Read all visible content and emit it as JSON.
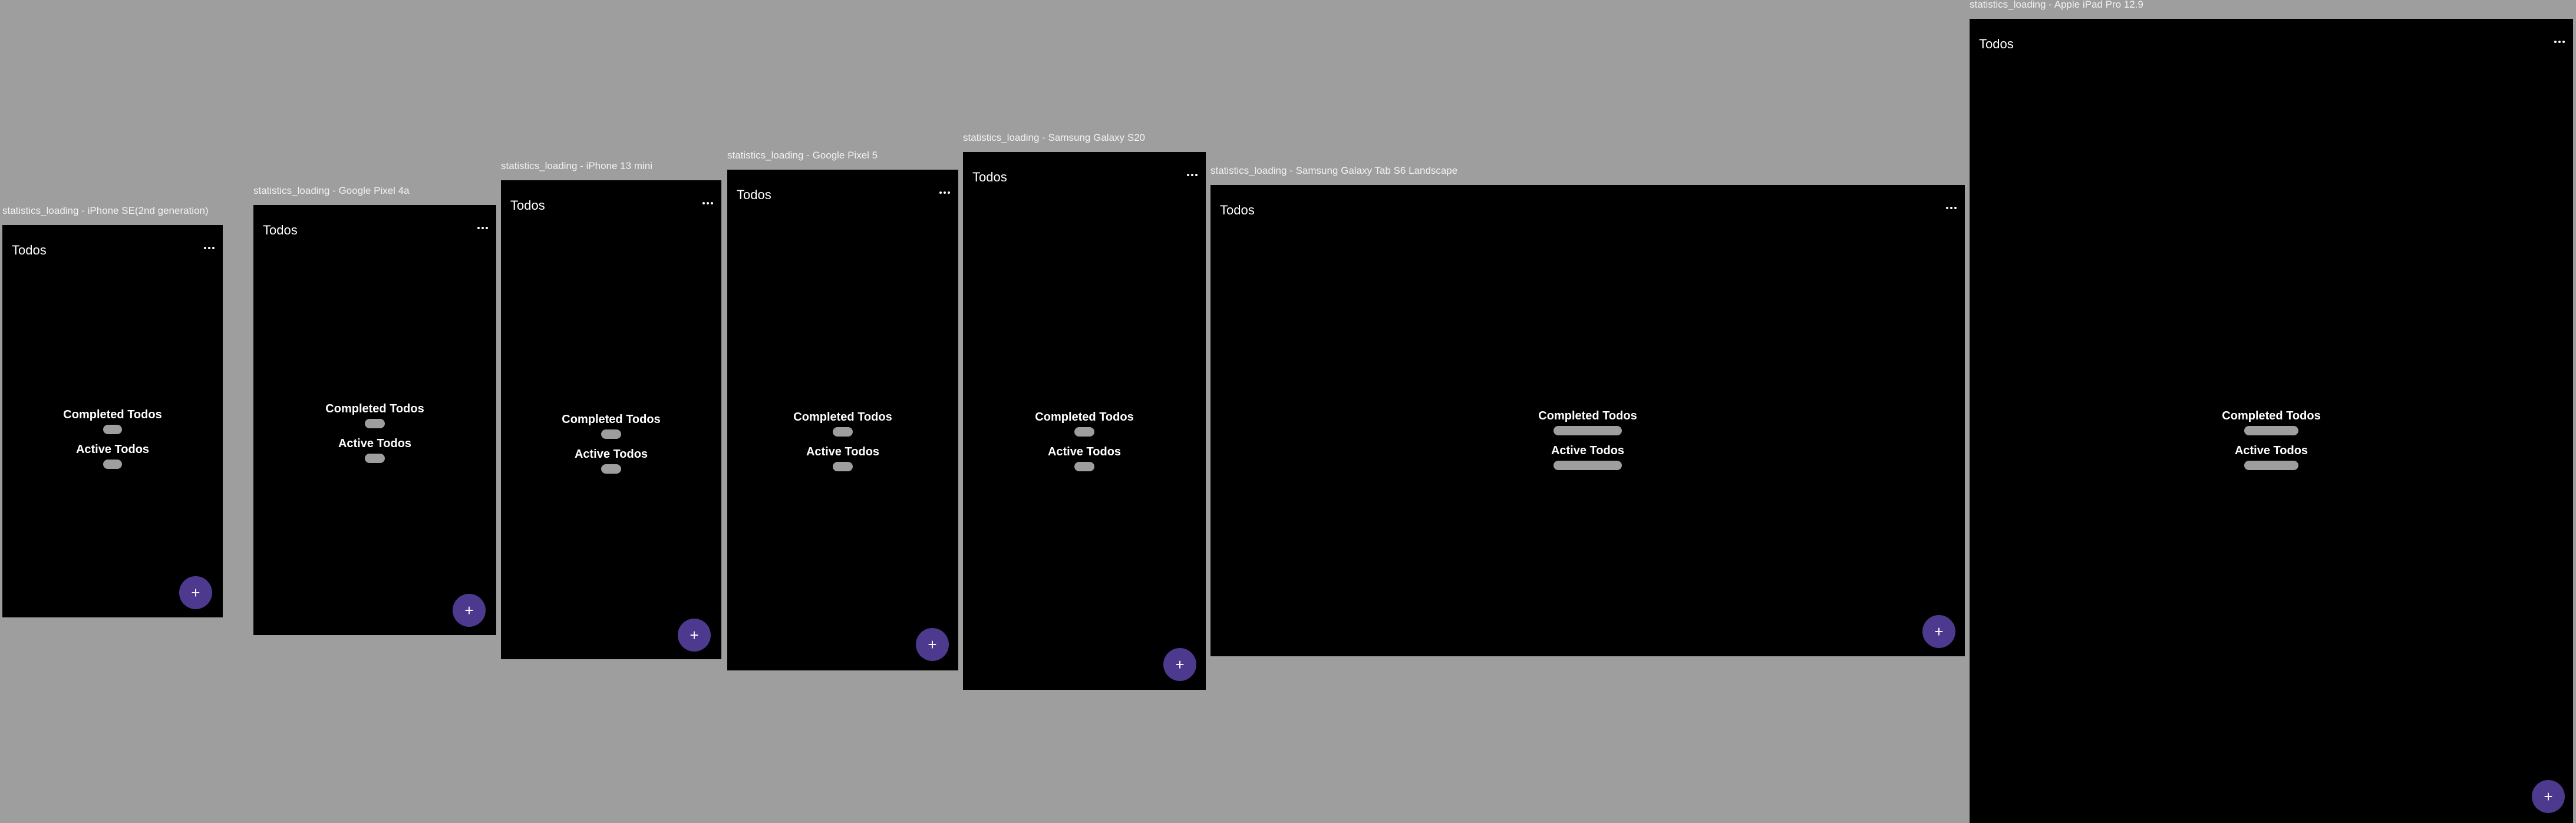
{
  "app": {
    "title": "Todos"
  },
  "stats": {
    "completed_label": "Completed Todos",
    "active_label": "Active Todos"
  },
  "fab": {
    "icon": "add-icon",
    "glyph": "+"
  },
  "menu": {
    "icon": "more-horiz-icon"
  },
  "colors": {
    "canvas": "#9e9e9e",
    "screen": "#000000",
    "accent": "#4d3a8f",
    "loading_placeholder": "#9e9e9e"
  },
  "frames": [
    {
      "caption": "statistics_loading - iPhone SE(2nd generation)"
    },
    {
      "caption": "statistics_loading - Google Pixel 4a"
    },
    {
      "caption": "statistics_loading - iPhone 13 mini"
    },
    {
      "caption": "statistics_loading - Google Pixel 5"
    },
    {
      "caption": "statistics_loading - Samsung Galaxy S20"
    },
    {
      "caption": "statistics_loading - Samsung Galaxy Tab S6 Landscape"
    },
    {
      "caption": "statistics_loading - Apple iPad Pro 12.9"
    }
  ]
}
